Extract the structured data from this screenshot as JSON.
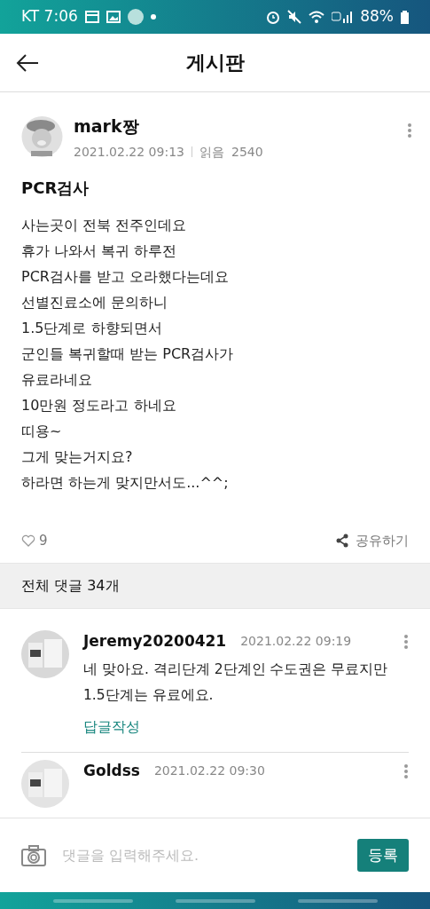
{
  "status_bar": {
    "carrier_time": "KT 7:06",
    "battery": "88%"
  },
  "header": {
    "title": "게시판"
  },
  "post": {
    "author": "mark짱",
    "date": "2021.02.22 09:13",
    "views_label": "읽음",
    "views": "2540",
    "title": "PCR검사",
    "body": [
      "사는곳이 전북 전주인데요",
      "휴가 나와서 복귀 하루전",
      "PCR검사를 받고 오라했다는데요",
      "선별진료소에 문의하니",
      "1.5단계로 하향되면서",
      "군인들 복귀할때 받는 PCR검사가",
      "유료라네요",
      "10만원 정도라고 하네요",
      "띠용~",
      "그게 맞는거지요?",
      "하라면 하는게 맞지만서도...^^;"
    ],
    "likes": "9",
    "share": "공유하기"
  },
  "comments_header": "전체 댓글 34개",
  "comments": [
    {
      "author": "Jeremy20200421",
      "date": "2021.02.22 09:19",
      "text": "네 맞아요. 격리단계 2단계인 수도권은 무료지만 1.5단계는 유료에요.",
      "reply": "답글작성"
    },
    {
      "author": "Goldss",
      "date": "2021.02.22 09:30"
    }
  ],
  "input": {
    "placeholder": "댓글을 입력해주세요.",
    "submit": "등록"
  }
}
